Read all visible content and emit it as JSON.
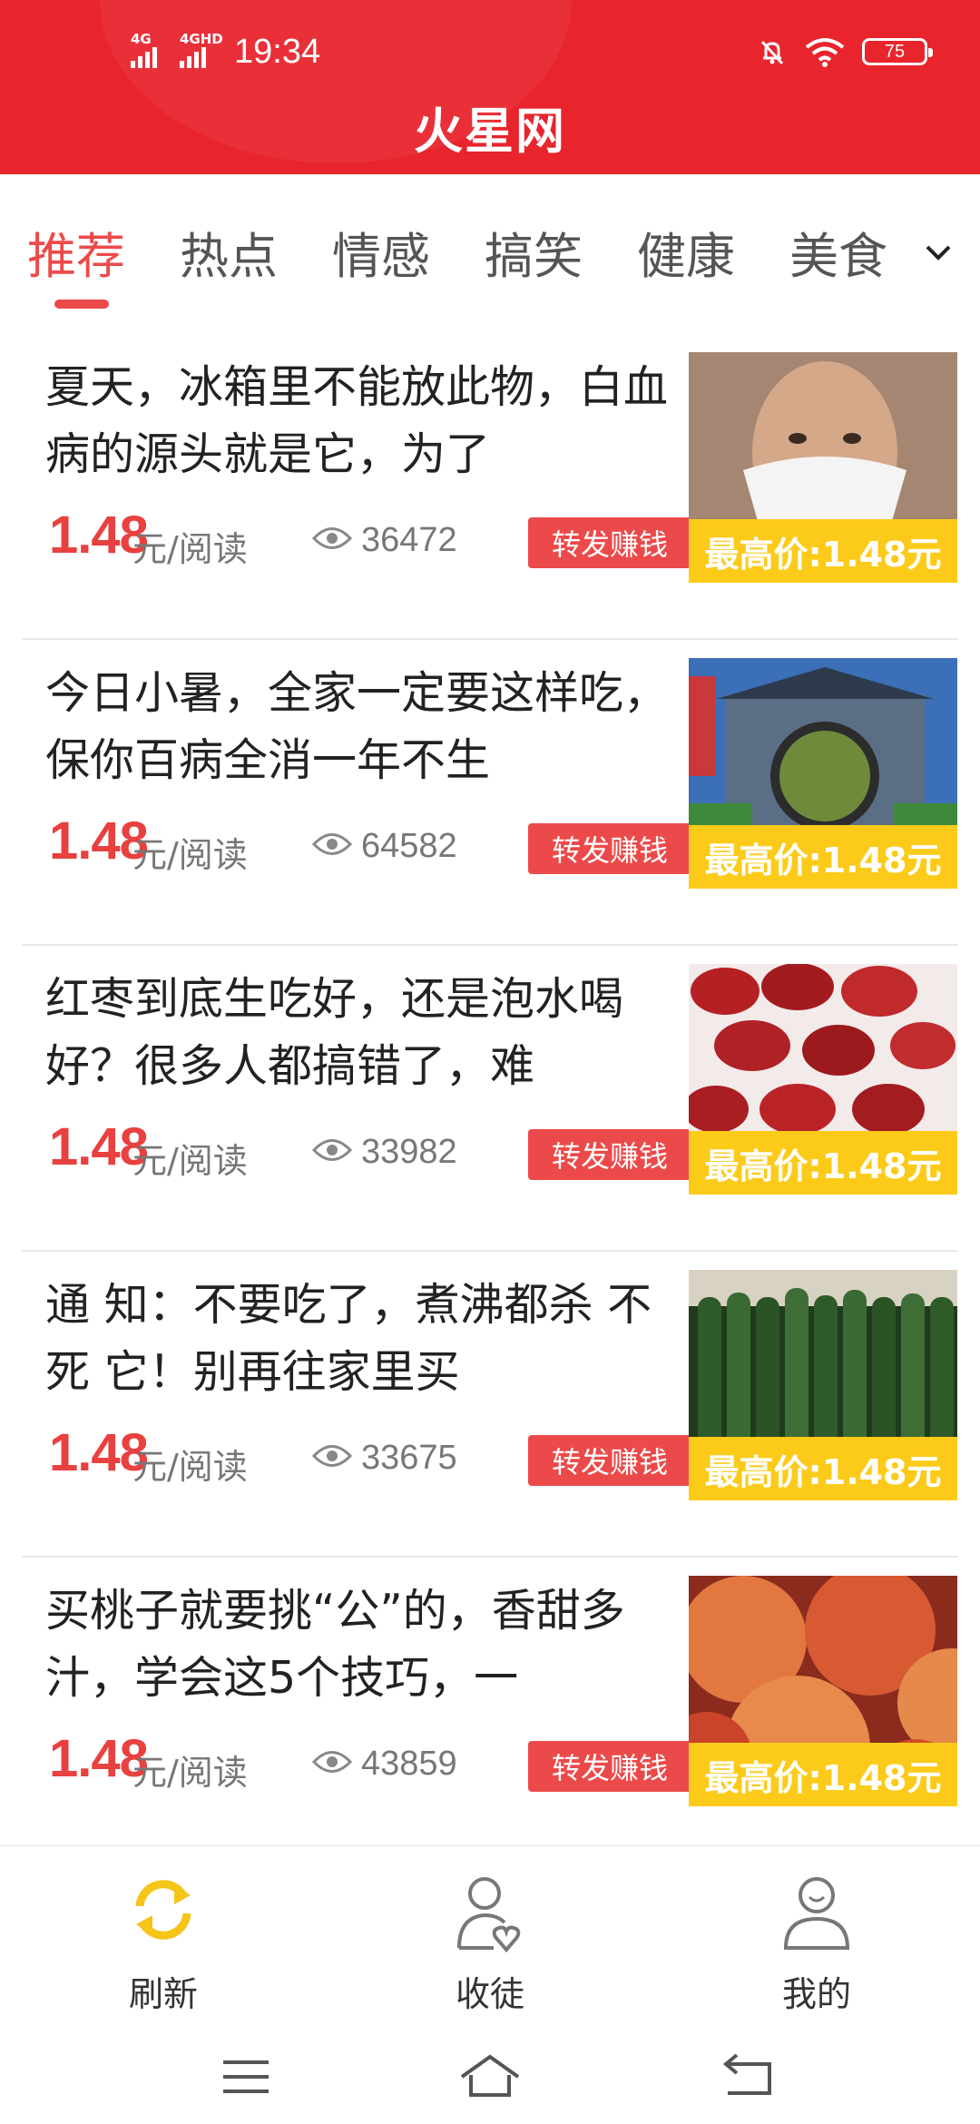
{
  "status_bar": {
    "signal1_label": "4G",
    "signal2_label": "4GHD",
    "time": "19:34",
    "battery": "75"
  },
  "header": {
    "title": "火星网"
  },
  "tabs": [
    {
      "label": "推荐",
      "active": true
    },
    {
      "label": "热点",
      "active": false
    },
    {
      "label": "情感",
      "active": false
    },
    {
      "label": "搞笑",
      "active": false
    },
    {
      "label": "健康",
      "active": false
    },
    {
      "label": "美食",
      "active": false
    }
  ],
  "feed": [
    {
      "title": "夏天，冰箱里不能放此物，白血病的源头就是它，为了",
      "price": "1.48",
      "unit": "元/阅读",
      "views": "36472",
      "share_label": "转发赚钱",
      "badge": "最高价:1.48元",
      "thumb_icon": "child-with-mask-photo"
    },
    {
      "title": "今日小暑，全家一定要这样吃，保你百病全消一年不生",
      "price": "1.48",
      "unit": "元/阅读",
      "views": "64582",
      "share_label": "转发赚钱",
      "badge": "最高价:1.48元",
      "thumb_icon": "courtyard-gate-photo"
    },
    {
      "title": "红枣到底生吃好，还是泡水喝好？很多人都搞错了，难",
      "price": "1.48",
      "unit": "元/阅读",
      "views": "33982",
      "share_label": "转发赚钱",
      "badge": "最高价:1.48元",
      "thumb_icon": "red-dates-photo"
    },
    {
      "title": "通 知：不要吃了，煮沸都杀 不 死 它！别再往家里买",
      "price": "1.48",
      "unit": "元/阅读",
      "views": "33675",
      "share_label": "转发赚钱",
      "badge": "最高价:1.48元",
      "thumb_icon": "cucumbers-photo"
    },
    {
      "title": "买桃子就要挑“公”的，香甜多汁，学会这5个技巧，一",
      "price": "1.48",
      "unit": "元/阅读",
      "views": "43859",
      "share_label": "转发赚钱",
      "badge": "最高价:1.48元",
      "thumb_icon": "peaches-photo"
    }
  ],
  "bottom_nav": [
    {
      "label": "刷新",
      "icon": "refresh-icon"
    },
    {
      "label": "收徒",
      "icon": "apprentice-icon"
    },
    {
      "label": "我的",
      "icon": "profile-icon"
    }
  ],
  "colors": {
    "brand": "#e8242d",
    "accent": "#ec4a4a",
    "badge": "#fccb1a",
    "refresh": "#f5c518"
  }
}
